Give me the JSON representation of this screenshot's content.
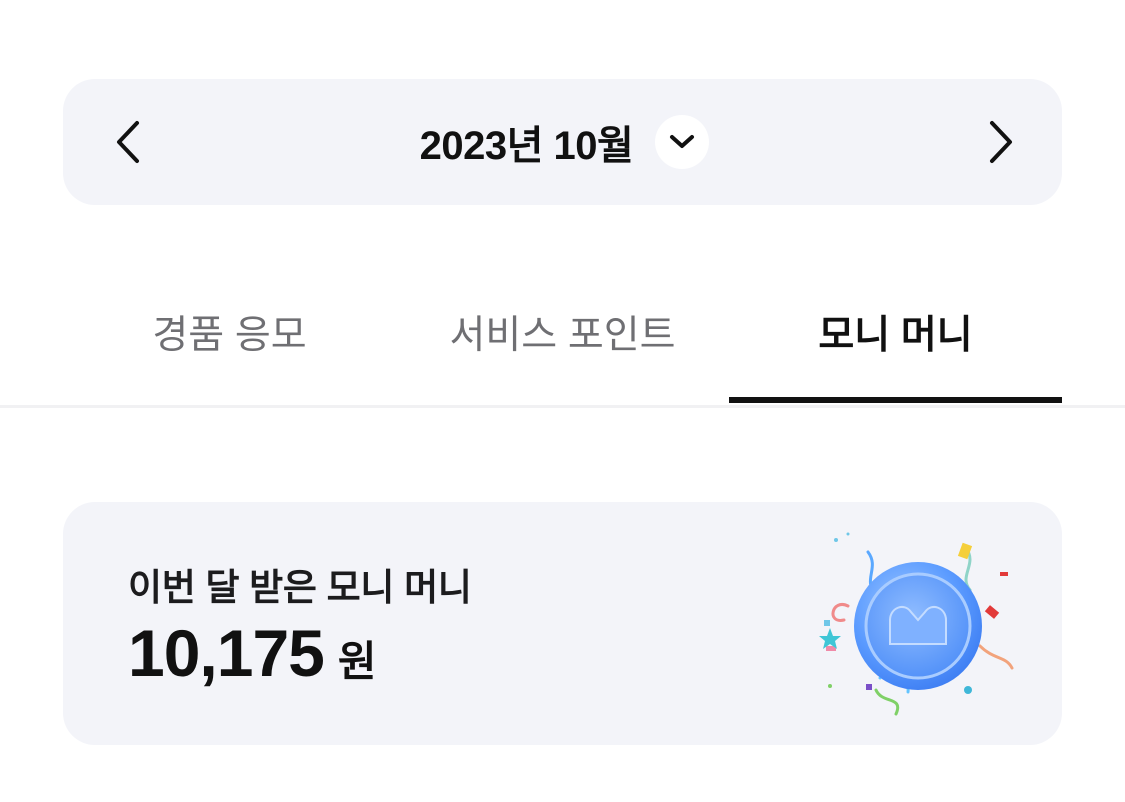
{
  "month_nav": {
    "label": "2023년 10월",
    "prev_icon": "chevron-left-icon",
    "next_icon": "chevron-right-icon",
    "dropdown_icon": "chevron-down-icon"
  },
  "tabs": [
    {
      "label": "경품 응모",
      "active": false
    },
    {
      "label": "서비스 포인트",
      "active": false
    },
    {
      "label": "모니 머니",
      "active": true
    }
  ],
  "summary_card": {
    "title": "이번 달 받은 모니 머니",
    "amount": "10,175",
    "unit": "원",
    "illustration": "coin-confetti-icon"
  },
  "colors": {
    "panel_bg": "#f3f4f9",
    "active_tab": "#111111",
    "inactive_tab": "#6f6f73",
    "coin_blue": "#5b9bff"
  }
}
